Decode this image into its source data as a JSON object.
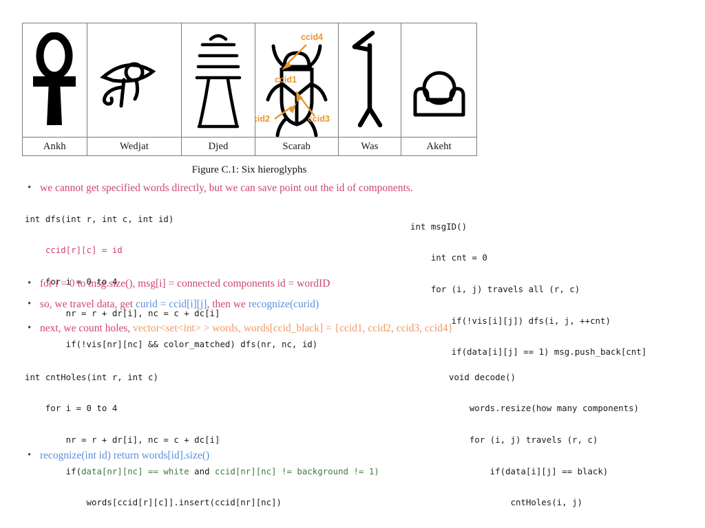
{
  "figure": {
    "caption": "Figure C.1: Six hieroglyphs",
    "cells": [
      {
        "label": "Ankh",
        "icon": "ankh-glyph"
      },
      {
        "label": "Wedjat",
        "icon": "wedjat-eye-glyph"
      },
      {
        "label": "Djed",
        "icon": "djed-pillar-glyph"
      },
      {
        "label": "Scarab",
        "icon": "scarab-beetle-glyph"
      },
      {
        "label": "Was",
        "icon": "was-scepter-glyph"
      },
      {
        "label": "Akeht",
        "icon": "akeht-horizon-glyph"
      }
    ],
    "annotations": [
      {
        "id": "ccid4",
        "text": "ccid4"
      },
      {
        "id": "ccid1",
        "text": "ccid1"
      },
      {
        "id": "ccid2",
        "text": "ccid2"
      },
      {
        "id": "ccid3",
        "text": "ccid3"
      }
    ],
    "annotation_color": "#E8962E"
  },
  "colors": {
    "pink": "#CC4477",
    "blue": "#5B8FDE",
    "orange": "#EE9966",
    "code_pink": "#D23C77",
    "code_green": "#3C7A3C",
    "border": "#7A7A7A"
  },
  "bullets": {
    "b1": {
      "text": "we cannot get specified words directly, but we can save point out the id of components."
    },
    "b2": {
      "text": "for i = 0 to msg.size(), msg[i] = connected components id = wordID"
    },
    "b3": {
      "seg1": "so, we travel data, get ",
      "seg2": "curid = ccid[i][j]",
      "seg3": ", then we ",
      "seg4": "recognize(curid)"
    },
    "b4": {
      "seg1": "next, we count holes, ",
      "seg2": "vector<set<int> > words,  words[ccid_black] = {ccid1, ccid2, ccid3, ccid4}"
    },
    "b5": {
      "text": "recognize(int id)  return words[id].size()"
    }
  },
  "code": {
    "dfs": {
      "l1": "int dfs(int r, int c, int id)",
      "l2": "    ccid[r][c] = id",
      "l3": "    for i = 0 to 4",
      "l4": "        nr = r + dr[i], nc = c + dc[i]",
      "l5": "        if(!vis[nr][nc] && color_matched) dfs(nr, nc, id)"
    },
    "msgid": {
      "l1": "int msgID()",
      "l2": "    int cnt = 0",
      "l3": "    for (i, j) travels all (r, c)",
      "l4": "        if(!vis[i][j]) dfs(i, j, ++cnt)",
      "l5": "        if(data[i][j] == 1) msg.push_back[cnt]"
    },
    "cntholes": {
      "l1": "int cntHoles(int r, int c)",
      "l2": "    for i = 0 to 4",
      "l3": "        nr = r + dr[i], nc = c + dc[i]",
      "l4a": "        if(",
      "l4b": "data[nr][nc] == white",
      "l4c": " and ",
      "l4d": "ccid[nr][nc] != background != 1)",
      "l5": "            words[ccid[r][c]].insert(ccid[nr][nc])"
    },
    "decode": {
      "l1": "void decode()",
      "l2": "    words.resize(how many components)",
      "l3": "    for (i, j) travels (r, c)",
      "l4": "        if(data[i][j] == black)",
      "l5": "            cntHoles(i, j)"
    }
  }
}
